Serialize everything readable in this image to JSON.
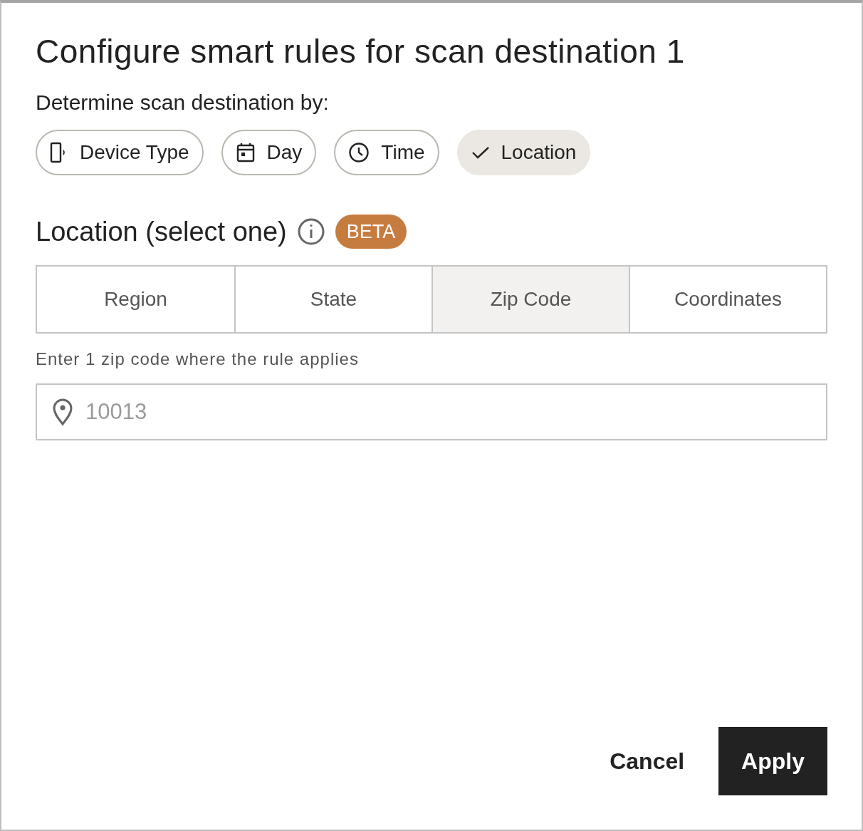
{
  "dialog": {
    "title": "Configure smart rules for scan destination 1",
    "criteria_label": "Determine scan destination by:",
    "criteria": [
      {
        "label": "Device Type",
        "kind": "device",
        "selected": false
      },
      {
        "label": "Day",
        "kind": "day",
        "selected": false
      },
      {
        "label": "Time",
        "kind": "time",
        "selected": false
      },
      {
        "label": "Location",
        "selected": true
      }
    ],
    "section": {
      "title": "Location (select one)",
      "badge": "BETA"
    },
    "location_tabs": [
      {
        "label": "Region",
        "selected": false
      },
      {
        "label": "State",
        "selected": false
      },
      {
        "label": "Zip Code",
        "selected": true
      },
      {
        "label": "Coordinates",
        "selected": false
      }
    ],
    "hint": "Enter 1 zip code where the rule applies",
    "zip_field": {
      "placeholder": "10013"
    },
    "buttons": [
      {
        "label": "Cancel",
        "kind": "text"
      },
      {
        "label": "Apply",
        "kind": "primary"
      }
    ]
  }
}
